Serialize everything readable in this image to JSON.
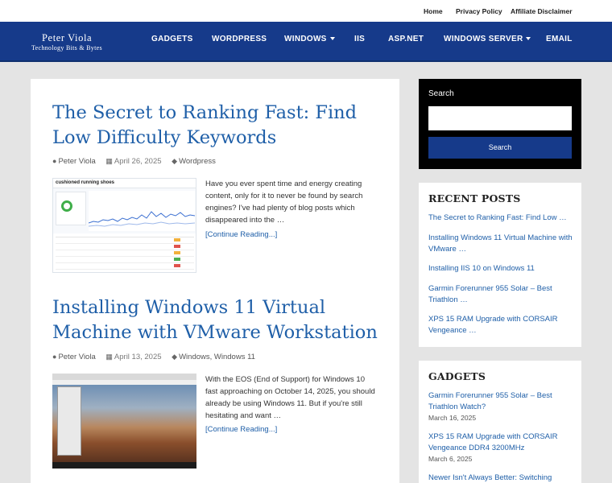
{
  "topbar": {
    "links": [
      "Home",
      "Privacy Policy",
      "Affiliate Disclaimer"
    ]
  },
  "header": {
    "logo_name": "Peter Viola",
    "logo_tagline": "Technology Bits & Bytes"
  },
  "nav": {
    "items": [
      "GADGETS",
      "WORDPRESS",
      "WINDOWS",
      "IIS",
      "ASP.NET",
      "WINDOWS SERVER",
      "EMAIL"
    ]
  },
  "posts": [
    {
      "title": "The Secret to Ranking Fast: Find Low Difficulty Keywords",
      "author": "Peter Viola",
      "date": "April 26, 2025",
      "categories": "Wordpress",
      "excerpt": "Have you ever spent time and energy creating content, only for it to never be found by search engines? I've had plenty of blog posts which disappeared into the …",
      "read_more": "[Continue Reading...]",
      "thumb_header": "cushioned running shoes"
    },
    {
      "title": "Installing Windows 11 Virtual Machine with VMware Workstation",
      "author": "Peter Viola",
      "date": "April 13, 2025",
      "categories": "Windows, Windows 11",
      "excerpt": "With the EOS (End of Support) for Windows 10 fast approaching on October 14, 2025, you should already be using Windows 11. But if you're still hesitating and want …",
      "read_more": "[Continue Reading...]"
    }
  ],
  "search": {
    "label": "Search",
    "placeholder": "",
    "button": "Search"
  },
  "recent_posts": {
    "title": "RECENT POSTS",
    "items": [
      "The Secret to Ranking Fast: Find Low …",
      "Installing Windows 11 Virtual Machine with VMware …",
      "Installing IIS 10 on Windows 11",
      "Garmin Forerunner 955 Solar – Best Triathlon …",
      "XPS 15 RAM Upgrade with CORSAIR Vengeance …"
    ]
  },
  "gadgets": {
    "title": "GADGETS",
    "items": [
      {
        "title": "Garmin Forerunner 955 Solar – Best Triathlon Watch?",
        "date": "March 16, 2025"
      },
      {
        "title": "XPS 15 RAM Upgrade with CORSAIR Vengeance DDR4 3200MHz",
        "date": "March 6, 2025"
      },
      {
        "title": "Newer Isn't Always Better: Switching"
      }
    ]
  },
  "colors": {
    "nav_bg": "#163a8a",
    "link": "#1f5fa8",
    "page_bg": "#e4e4e4"
  }
}
